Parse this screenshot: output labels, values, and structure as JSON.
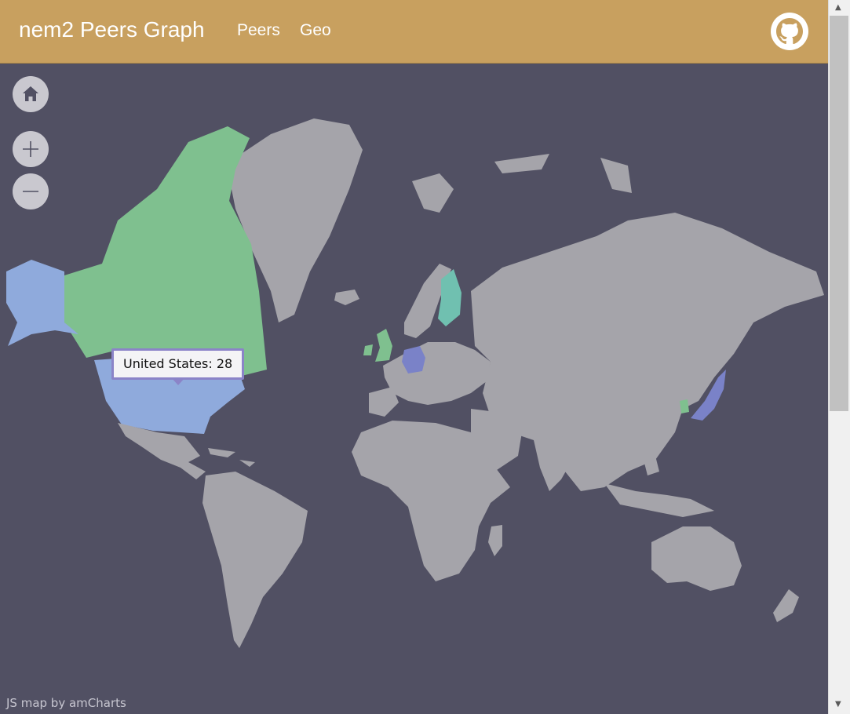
{
  "header": {
    "title": "nem2 Peers Graph",
    "nav": [
      "Peers",
      "Geo"
    ],
    "github_icon": "github-icon",
    "background": "#c8a05f"
  },
  "map": {
    "background": "#515063",
    "land_color": "#a5a4aa",
    "highlighted": [
      {
        "name": "United States",
        "color": "#8faadc"
      },
      {
        "name": "Canada",
        "color": "#7fc08f"
      },
      {
        "name": "United Kingdom",
        "color": "#7fc08f"
      },
      {
        "name": "Germany",
        "color": "#7a82c8"
      },
      {
        "name": "Finland",
        "color": "#70c0b0"
      },
      {
        "name": "Japan",
        "color": "#7a82c8"
      },
      {
        "name": "South Korea",
        "color": "#7fc08f"
      }
    ],
    "tooltip": "United States: 28",
    "credit": "JS map by amCharts"
  },
  "controls": {
    "home_icon": "home-icon",
    "zoom_in_icon": "plus-icon",
    "zoom_out_icon": "minus-icon"
  },
  "scrollbar": {
    "up_icon": "arrow-up-icon",
    "down_icon": "arrow-down-icon"
  }
}
